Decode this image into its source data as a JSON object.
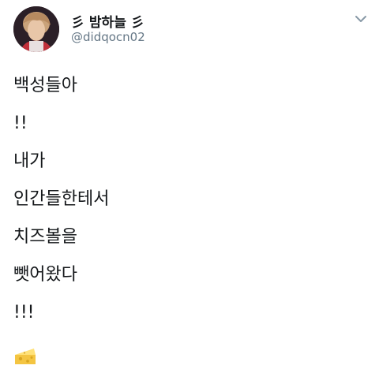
{
  "user": {
    "display_name": "彡 밤하늘 彡",
    "handle": "@didqocn02"
  },
  "tweet": {
    "lines": [
      "백성들아",
      "!!",
      "내가",
      "인간들한테서",
      "치즈볼을",
      "뺏어왔다",
      "!!!"
    ],
    "emoji": "cheese-wedge"
  },
  "icons": {
    "menu": "chevron-down-icon",
    "emoji": "cheese-wedge-icon"
  },
  "colors": {
    "text": "#14171a",
    "secondary": "#657786",
    "cheese": "#f4c542"
  }
}
